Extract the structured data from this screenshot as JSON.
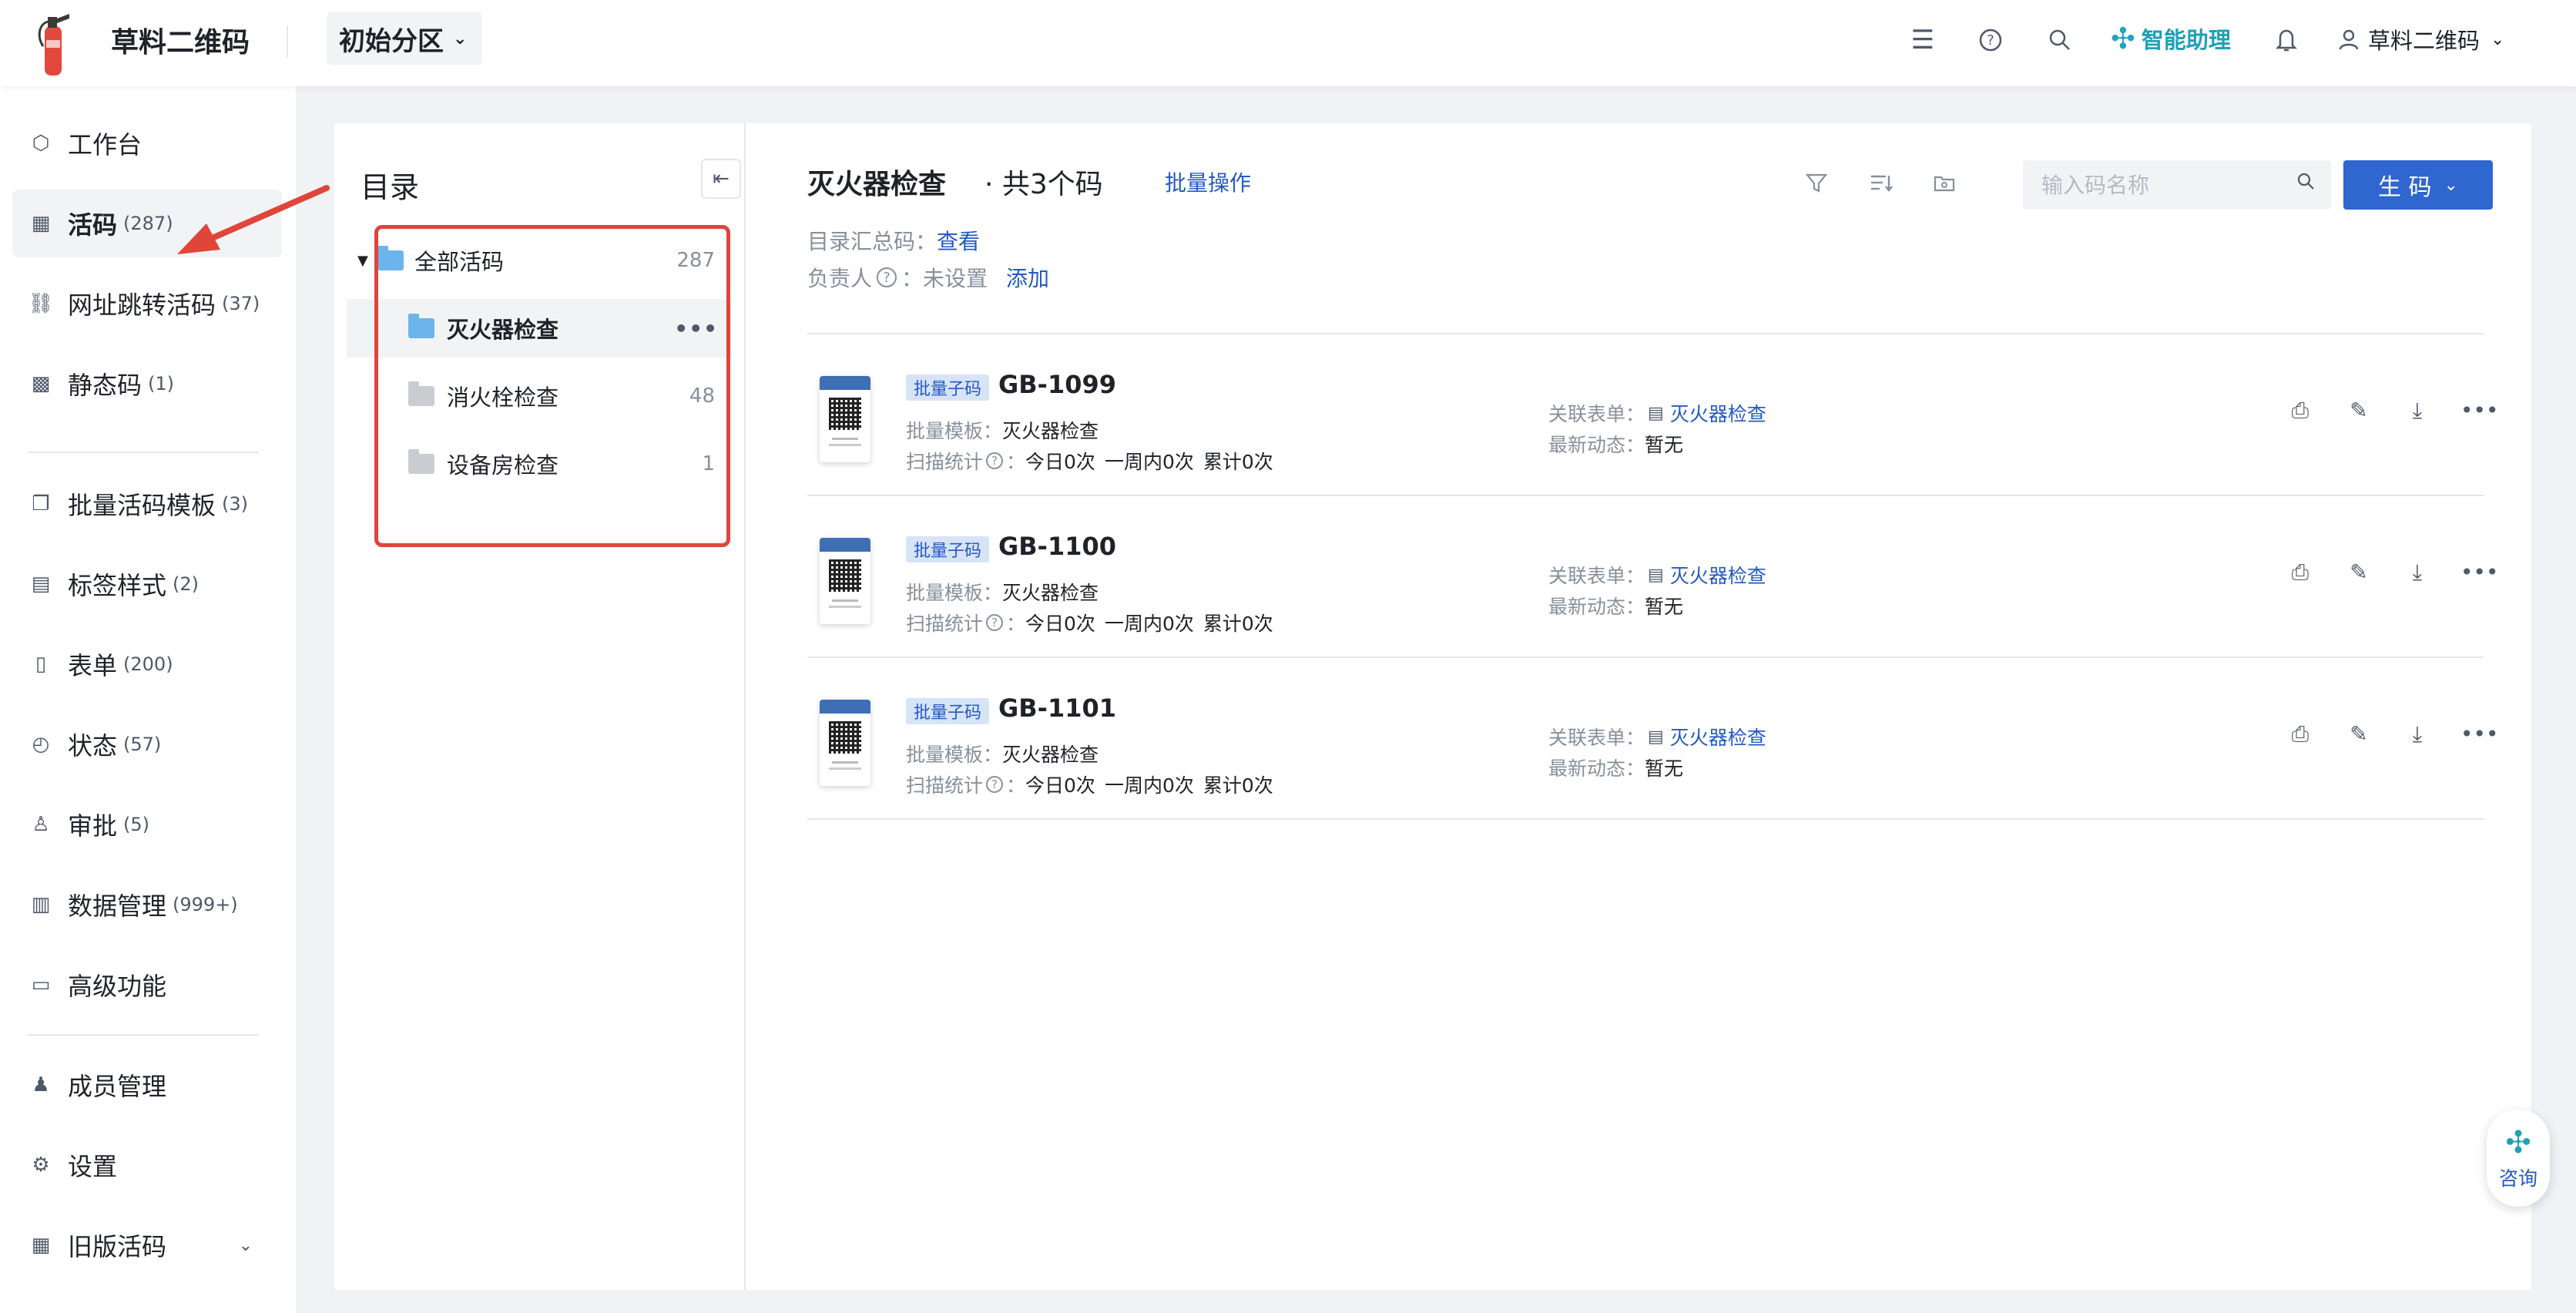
{
  "header": {
    "app_name": "草料二维码",
    "partition": "初始分区",
    "assistant_label": "智能助理",
    "user_name": "草料二维码"
  },
  "sidebar": {
    "items": [
      {
        "label": "工作台",
        "count": "",
        "icon": "cube-icon"
      },
      {
        "label": "活码",
        "count": "(287)",
        "icon": "grid-icon"
      },
      {
        "label": "网址跳转活码",
        "count": "(37)",
        "icon": "link-icon"
      },
      {
        "label": "静态码",
        "count": "(1)",
        "icon": "qr-icon"
      },
      {
        "label": "批量活码模板",
        "count": "(3)",
        "icon": "copy-icon"
      },
      {
        "label": "标签样式",
        "count": "(2)",
        "icon": "label-icon"
      },
      {
        "label": "表单",
        "count": "(200)",
        "icon": "clipboard-icon"
      },
      {
        "label": "状态",
        "count": "(57)",
        "icon": "status-icon"
      },
      {
        "label": "审批",
        "count": "(5)",
        "icon": "stamp-icon"
      },
      {
        "label": "数据管理",
        "count": "(999+)",
        "icon": "bar-chart-icon"
      },
      {
        "label": "高级功能",
        "count": "",
        "icon": "briefcase-icon"
      },
      {
        "label": "成员管理",
        "count": "",
        "icon": "member-icon"
      },
      {
        "label": "设置",
        "count": "",
        "icon": "gear-icon"
      },
      {
        "label": "旧版活码",
        "count": "",
        "icon": "grid-icon"
      }
    ]
  },
  "tree": {
    "title": "目录",
    "nodes": [
      {
        "label": "全部活码",
        "count": "287"
      },
      {
        "label": "灭火器检查",
        "count": ""
      },
      {
        "label": "消火栓检查",
        "count": "48"
      },
      {
        "label": "设备房检查",
        "count": "1"
      }
    ]
  },
  "content": {
    "title": "灭火器检查",
    "count_text": "· 共3个码",
    "batch_label": "批量操作",
    "summary_label": "目录汇总码：",
    "summary_link": "查看",
    "owner_label": "负责人",
    "owner_value": "：未设置",
    "owner_add": "添加",
    "search_placeholder": "输入码名称",
    "generate_label": "生 码",
    "rows": [
      {
        "tag": "批量子码",
        "name": "GB-1099",
        "template_label": "批量模板：",
        "template_value": "灭火器检查",
        "scan_label": "扫描统计",
        "scan_sep": "：",
        "today": "今日0次",
        "week": "一周内0次",
        "total": "累计0次",
        "rel_label": "关联表单：",
        "rel_value": "灭火器检查",
        "news_label": "最新动态：",
        "news_value": "暂无"
      },
      {
        "tag": "批量子码",
        "name": "GB-1100",
        "template_label": "批量模板：",
        "template_value": "灭火器检查",
        "scan_label": "扫描统计",
        "scan_sep": "：",
        "today": "今日0次",
        "week": "一周内0次",
        "total": "累计0次",
        "rel_label": "关联表单：",
        "rel_value": "灭火器检查",
        "news_label": "最新动态：",
        "news_value": "暂无"
      },
      {
        "tag": "批量子码",
        "name": "GB-1101",
        "template_label": "批量模板：",
        "template_value": "灭火器检查",
        "scan_label": "扫描统计",
        "scan_sep": "：",
        "today": "今日0次",
        "week": "一周内0次",
        "total": "累计0次",
        "rel_label": "关联表单：",
        "rel_value": "灭火器检查",
        "news_label": "最新动态：",
        "news_value": "暂无"
      }
    ]
  },
  "consult_label": "咨询",
  "colors": {
    "accent": "#2f66cf",
    "link": "#2459c4",
    "annotation": "#e0453a",
    "assistant": "#1fa0b5"
  }
}
